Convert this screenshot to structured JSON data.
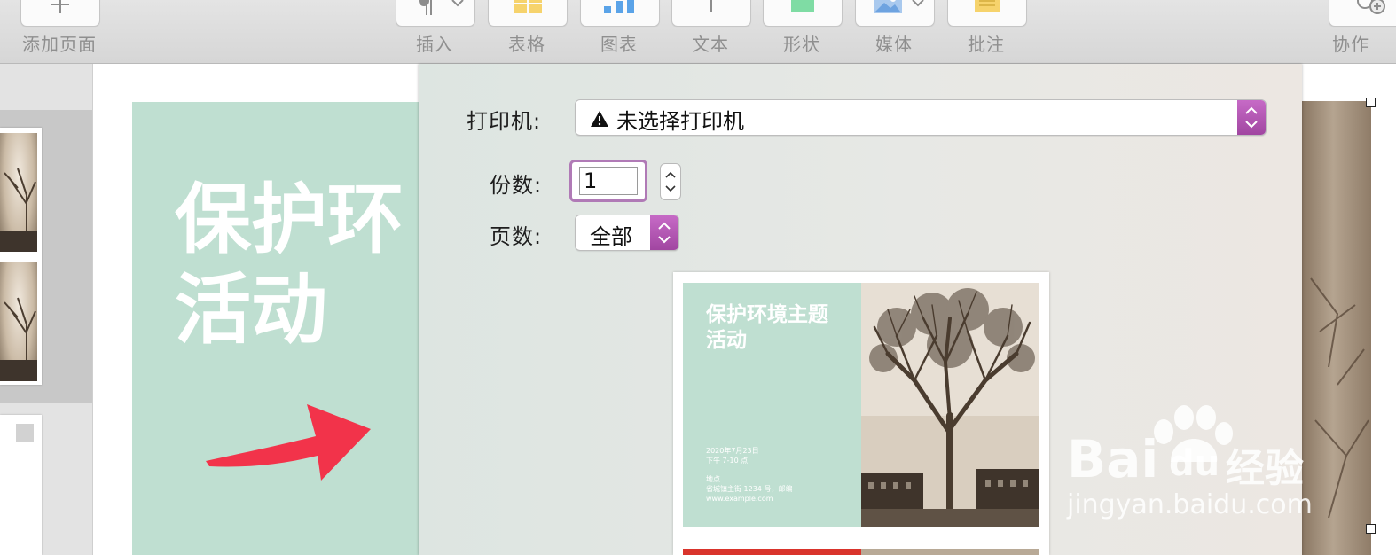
{
  "toolbar": {
    "add_page": "添加页面",
    "insert": "插入",
    "table": "表格",
    "chart": "图表",
    "text": "文本",
    "shape": "形状",
    "media": "媒体",
    "comment": "批注",
    "collaborate": "协作"
  },
  "slide": {
    "title": "保护环\n活动",
    "accent_color": "#bfdfd1",
    "arrow_color": "#f2334a"
  },
  "print": {
    "printer_label": "打印机:",
    "printer_value": "未选择打印机",
    "copies_label": "份数:",
    "copies_value": "1",
    "pages_label": "页数:",
    "pages_value": "全部"
  },
  "preview": {
    "title": "保护环境主题\n活动",
    "date": "2020年7月23日\n下午 7-10 点",
    "location": "地点\n省城镇主街 1234 号，邮编\nwww.example.com"
  },
  "watermark": {
    "brand": "Bai",
    "brand_du": "du",
    "brand_cn": "经验",
    "url": "jingyan.baidu.com"
  }
}
